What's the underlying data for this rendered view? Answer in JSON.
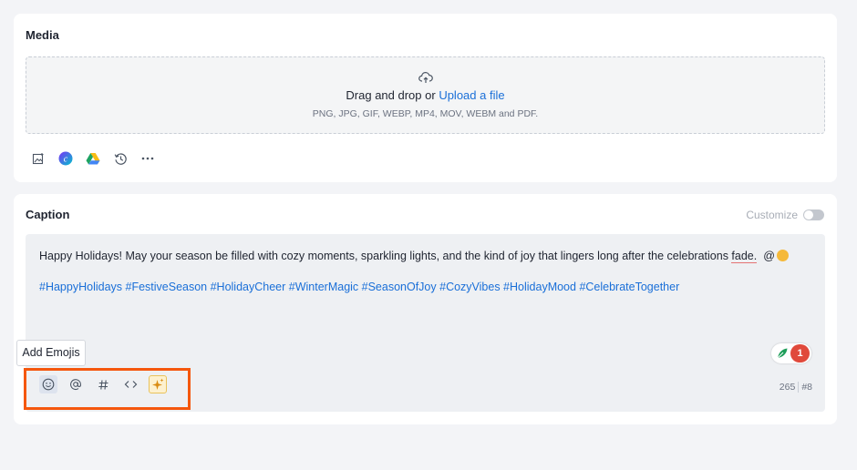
{
  "media": {
    "title": "Media",
    "dropzone": {
      "main_text": "Drag and drop or ",
      "link_text": "Upload a file",
      "formats": "PNG, JPG, GIF, WEBP, MP4, MOV, WEBM and PDF."
    },
    "tools": [
      {
        "icon": "image-icon"
      },
      {
        "icon": "canva-icon"
      },
      {
        "icon": "google-drive-icon"
      },
      {
        "icon": "history-icon"
      },
      {
        "icon": "more-icon"
      }
    ]
  },
  "caption": {
    "title": "Caption",
    "customize_label": "Customize",
    "customize_enabled": false,
    "text_before": "Happy Holidays! May your season be filled with cozy moments, sparkling lights, and the kind of joy that lingers long after the celebrations ",
    "text_fade": "fade.",
    "text_mention": "@",
    "hashtags": "#HappyHolidays #FestiveSeason #HolidayCheer #WinterMagic #SeasonOfJoy #CozyVibes #HolidayMood #CelebrateTogether",
    "grammar_issue_count": "1",
    "char_count": "265",
    "hashtag_count": "#8",
    "tooltip": "Add Emojis",
    "tools": [
      {
        "icon": "emoji-icon"
      },
      {
        "icon": "mention-icon"
      },
      {
        "icon": "hashtag-icon"
      },
      {
        "icon": "code-icon"
      },
      {
        "icon": "ai-sparkle-icon"
      }
    ]
  },
  "colors": {
    "accent_link": "#1a6fd8",
    "highlight": "#f5570d",
    "badge_red": "#e0493b"
  }
}
